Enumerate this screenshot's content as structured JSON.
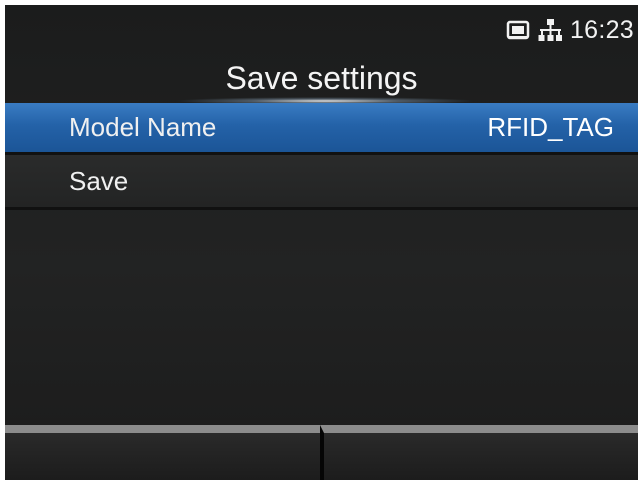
{
  "status": {
    "icons": [
      "sd-card-icon",
      "network-icon"
    ],
    "time": "16:23"
  },
  "header": {
    "title": "Save settings"
  },
  "menu": {
    "items": [
      {
        "label": "Model Name",
        "value": "RFID_TAG",
        "selected": true
      },
      {
        "label": "Save",
        "value": "",
        "selected": false
      }
    ]
  },
  "softkeys": [
    {
      "label": ""
    },
    {
      "label": ""
    }
  ],
  "colors": {
    "selection": "#2462a8",
    "background": "#1f2020",
    "text": "#f0f0f0"
  }
}
